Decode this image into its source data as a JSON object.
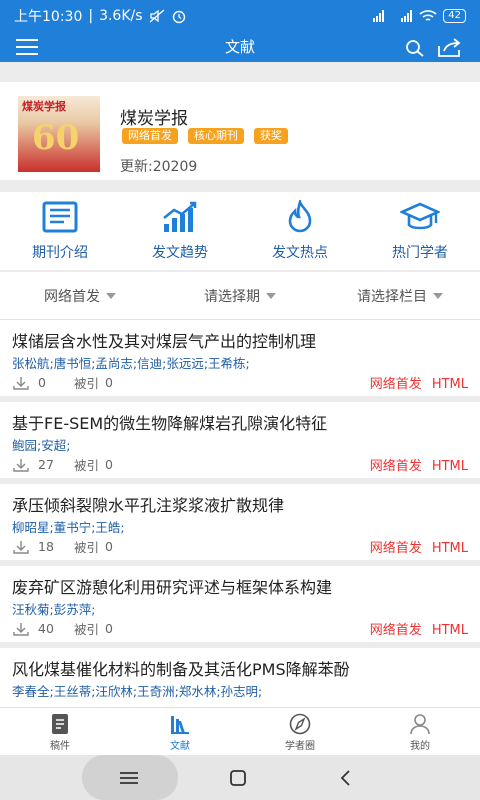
{
  "status_bar": {
    "time": "上午10:30",
    "separator": "|",
    "speed": "3.6K/s",
    "battery": "42"
  },
  "app_bar": {
    "title": "文献"
  },
  "journal": {
    "cover_title": "煤炭学报",
    "cover_number": "60",
    "name": "煤炭学报",
    "tags": [
      "网络首发",
      "核心期刊",
      "获奖"
    ],
    "update": "更新:20209"
  },
  "features": [
    {
      "label": "期刊介绍",
      "icon": "journal-intro-icon"
    },
    {
      "label": "发文趋势",
      "icon": "trend-chart-icon"
    },
    {
      "label": "发文热点",
      "icon": "flame-icon"
    },
    {
      "label": "热门学者",
      "icon": "graduation-cap-icon"
    }
  ],
  "filters": [
    {
      "label": "网络首发"
    },
    {
      "label": "请选择期"
    },
    {
      "label": "请选择栏目"
    }
  ],
  "articles": [
    {
      "title": "煤储层含水性及其对煤层气产出的控制机理",
      "authors": "张松航;唐书恒;孟尚志;信迪;张远远;王希栋;",
      "downloads": "0",
      "cited_label": "被引",
      "cited": "0",
      "badge1": "网络首发",
      "badge2": "HTML"
    },
    {
      "title": "基于FE-SEM的微生物降解煤岩孔隙演化特征",
      "authors": "鲍园;安超;",
      "downloads": "27",
      "cited_label": "被引",
      "cited": "0",
      "badge1": "网络首发",
      "badge2": "HTML"
    },
    {
      "title": "承压倾斜裂隙水平孔注浆浆液扩散规律",
      "authors": "柳昭星;董书宁;王皓;",
      "downloads": "18",
      "cited_label": "被引",
      "cited": "0",
      "badge1": "网络首发",
      "badge2": "HTML"
    },
    {
      "title": "废弃矿区游憩化利用研究评述与框架体系构建",
      "authors": "汪秋菊;彭苏萍;",
      "downloads": "40",
      "cited_label": "被引",
      "cited": "0",
      "badge1": "网络首发",
      "badge2": "HTML"
    },
    {
      "title": "风化煤基催化材料的制备及其活化PMS降解苯酚",
      "authors": "李春全;王丝蒂;汪欣林;王奇洲;郑水林;孙志明;",
      "downloads": "",
      "cited_label": "",
      "cited": "",
      "badge1": "",
      "badge2": ""
    }
  ],
  "tabs": [
    {
      "label": "稿件",
      "icon": "manuscript-icon"
    },
    {
      "label": "文献",
      "icon": "literature-icon"
    },
    {
      "label": "学者圈",
      "icon": "compass-icon"
    },
    {
      "label": "我的",
      "icon": "profile-icon"
    }
  ],
  "colors": {
    "primary": "#1f7fd9",
    "tag_orange": "#f7a21e",
    "badge_red": "#e33333",
    "author_blue": "#1f5fa8"
  }
}
